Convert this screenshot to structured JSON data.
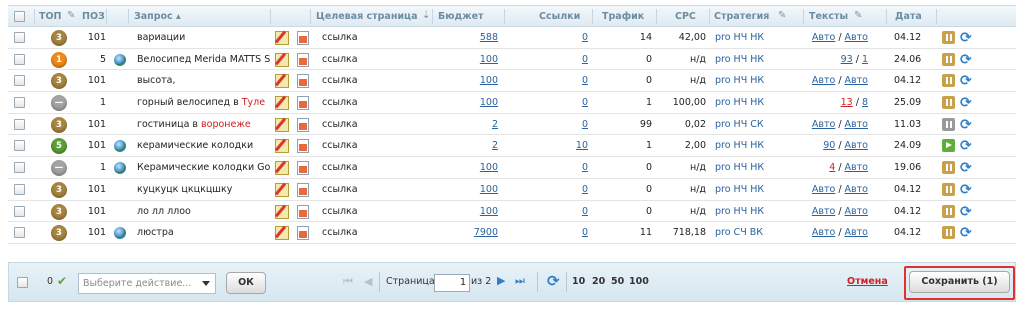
{
  "header": {
    "top": "ТОП",
    "pos": "ПОЗ",
    "query": "Запрос ▴",
    "target": "Целевая страница",
    "budget": "Бюджет",
    "links": "Ссылки",
    "traffic": "Трафик",
    "cpc": "CPC",
    "strategy": "Стратегия",
    "texts": "Тексты",
    "date": "Дата"
  },
  "rows": [
    {
      "top": "3",
      "badge_color": "brown",
      "pos": "101",
      "globe": false,
      "query": "вариации",
      "query_red": "",
      "target": "ссылка",
      "budget": "588",
      "budget_link": true,
      "links": "0",
      "traffic": "14",
      "cpc": "42,00",
      "strategy": "pro НЧ НК",
      "text1": "Авто",
      "text2": "Авто",
      "text1_red": false,
      "date": "04.12",
      "pause": "brown"
    },
    {
      "top": "1",
      "badge_color": "orange",
      "pos": "5",
      "globe": true,
      "query": "Велосипед Merida MATTS SPC",
      "query_red": "",
      "target": "ссылка",
      "budget": "100",
      "budget_link": true,
      "links": "0",
      "traffic": "0",
      "cpc": "н/д",
      "strategy": "pro НЧ НК",
      "text1": "93",
      "text2": "1",
      "text1_red": false,
      "date": "24.06",
      "pause": "brown"
    },
    {
      "top": "3",
      "badge_color": "brown",
      "pos": "101",
      "globe": false,
      "query": "высота,",
      "query_red": "",
      "target": "ссылка",
      "budget": "100",
      "budget_link": true,
      "links": "0",
      "traffic": "0",
      "cpc": "н/д",
      "strategy": "pro НЧ НК",
      "text1": "Авто",
      "text2": "Авто",
      "text1_red": false,
      "date": "04.12",
      "pause": "brown"
    },
    {
      "top": "—",
      "badge_color": "gray",
      "pos": "1",
      "globe": false,
      "query": "горный велосипед в ",
      "query_red": "Туле",
      "target": "ссылка",
      "budget": "100",
      "budget_link": true,
      "links": "0",
      "traffic": "1",
      "cpc": "100,00",
      "strategy": "pro НЧ НК",
      "text1": "13",
      "text2": "8",
      "text1_red": true,
      "date": "25.09",
      "pause": "brown"
    },
    {
      "top": "3",
      "badge_color": "brown",
      "pos": "101",
      "globe": false,
      "query": "гостиница в ",
      "query_red": "воронеже",
      "target": "ссылка",
      "budget": "2",
      "budget_link": true,
      "links": "0",
      "traffic": "99",
      "cpc": "0,02",
      "strategy": "pro НЧ СК",
      "text1": "Авто",
      "text2": "Авто",
      "text1_red": false,
      "date": "11.03",
      "pause": "gray"
    },
    {
      "top": "5",
      "badge_color": "green",
      "pos": "101",
      "globe": true,
      "query": "керамические колодки",
      "query_red": "",
      "target": "ссылка",
      "budget": "2",
      "budget_link": true,
      "links": "10",
      "traffic": "1",
      "cpc": "2,00",
      "strategy": "pro НЧ НК",
      "text1": "90",
      "text2": "Авто",
      "text1_red": false,
      "date": "24.09",
      "pause": "green"
    },
    {
      "top": "—",
      "badge_color": "gray",
      "pos": "1",
      "globe": true,
      "query": "Керамические колодки Gooc",
      "query_red": "",
      "target": "ссылка",
      "budget": "100",
      "budget_link": true,
      "links": "0",
      "traffic": "0",
      "cpc": "н/д",
      "strategy": "pro НЧ НК",
      "text1": "4",
      "text2": "Авто",
      "text1_red": true,
      "date": "19.06",
      "pause": "brown"
    },
    {
      "top": "3",
      "badge_color": "brown",
      "pos": "101",
      "globe": false,
      "query": "куцкуцк цкцкцшку",
      "query_red": "",
      "target": "ссылка",
      "budget": "100",
      "budget_link": true,
      "links": "0",
      "traffic": "0",
      "cpc": "н/д",
      "strategy": "pro НЧ НК",
      "text1": "Авто",
      "text2": "Авто",
      "text1_red": false,
      "date": "04.12",
      "pause": "brown"
    },
    {
      "top": "3",
      "badge_color": "brown",
      "pos": "101",
      "globe": false,
      "query": "ло лл ллоо",
      "query_red": "",
      "target": "ссылка",
      "budget": "100",
      "budget_link": true,
      "links": "0",
      "traffic": "0",
      "cpc": "н/д",
      "strategy": "pro НЧ НК",
      "text1": "Авто",
      "text2": "Авто",
      "text1_red": false,
      "date": "04.12",
      "pause": "brown"
    },
    {
      "top": "3",
      "badge_color": "brown",
      "pos": "101",
      "globe": true,
      "query": "люстра",
      "query_red": "",
      "target": "ссылка",
      "budget": "7900",
      "budget_link": true,
      "links": "0",
      "traffic": "11",
      "cpc": "718,18",
      "strategy": "pro СЧ ВК",
      "text1": "Авто",
      "text2": "Авто",
      "text1_red": false,
      "date": "04.12",
      "pause": "brown"
    }
  ],
  "footer": {
    "selected_count": "0",
    "action_placeholder": "Выберите действие...",
    "ok_label": "ОК",
    "page_label": "Страница",
    "page_value": "1",
    "page_total": "из 2",
    "page_sizes": [
      "10",
      "20",
      "50",
      "100"
    ],
    "cancel_label": "Отмена",
    "save_label": "Сохранить (1)"
  },
  "colors": {
    "link": "#2a62a0",
    "header_text": "#6b8da3",
    "cancel": "#d02020",
    "save_highlight": "#e0302f"
  }
}
